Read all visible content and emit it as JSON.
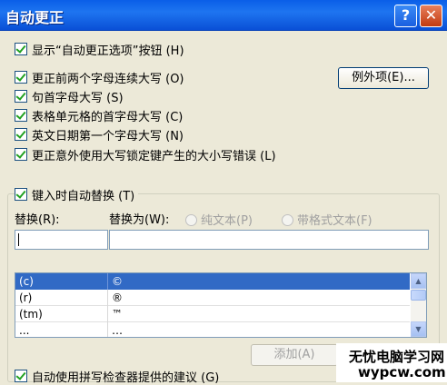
{
  "window": {
    "title": "自动更正",
    "help_label": "?",
    "close_label": "✕"
  },
  "options": [
    {
      "label": "显示“自动更正选项”按钮 (H)",
      "checked": true
    },
    {
      "label": "更正前两个字母连续大写 (O)",
      "checked": true
    },
    {
      "label": "句首字母大写 (S)",
      "checked": true
    },
    {
      "label": "表格单元格的首字母大写 (C)",
      "checked": true
    },
    {
      "label": "英文日期第一个字母大写 (N)",
      "checked": true
    },
    {
      "label": "更正意外使用大写锁定键产生的大小写错误 (L)",
      "checked": true
    }
  ],
  "exceptions_button": "例外项(E)...",
  "replace_group": {
    "toggle_label": "键入时自动替换 (T)",
    "replace_label": "替换(R):",
    "with_label": "替换为(W):",
    "radio_plain": "纯文本(P)",
    "radio_formatted": "带格式文本(F)",
    "replace_value": "",
    "with_value": ""
  },
  "list_rows": [
    {
      "key": "(c)",
      "value": "©",
      "selected": true
    },
    {
      "key": "(r)",
      "value": "®",
      "selected": false
    },
    {
      "key": "(tm)",
      "value": "™",
      "selected": false
    },
    {
      "key": "...",
      "value": "…",
      "selected": false
    }
  ],
  "add_button": "添加(A)",
  "spell_option": "自动使用拼写检查器提供的建议 (G)",
  "watermark": {
    "line1": "无忧电脑学习网",
    "line2": "wypcw.com"
  },
  "icons": {
    "check": "check-icon",
    "scroll_up": "arrow-up-icon",
    "scroll_down": "arrow-down-icon"
  }
}
